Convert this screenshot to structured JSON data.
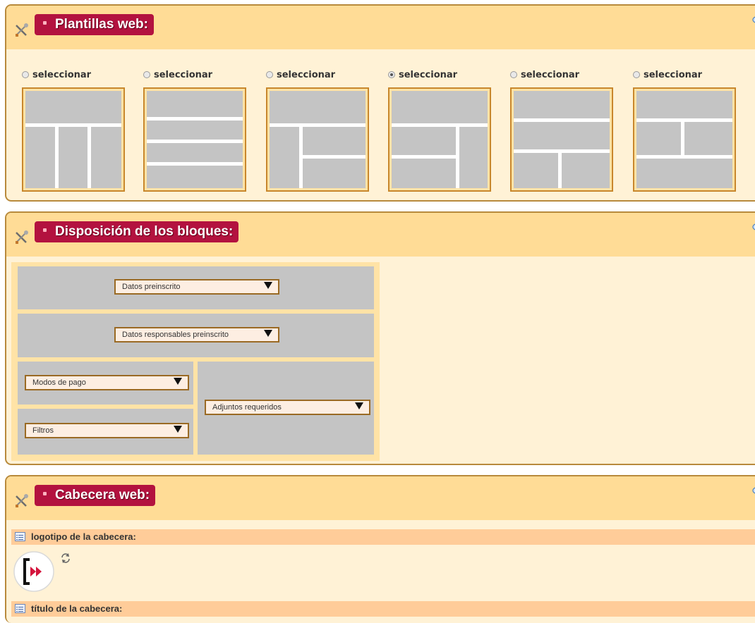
{
  "panels": {
    "templates": {
      "title": "Plantillas web:",
      "options": [
        {
          "label": "seleccionar",
          "selected": false
        },
        {
          "label": "seleccionar",
          "selected": false
        },
        {
          "label": "seleccionar",
          "selected": false
        },
        {
          "label": "seleccionar",
          "selected": true
        },
        {
          "label": "seleccionar",
          "selected": false
        },
        {
          "label": "seleccionar",
          "selected": false
        }
      ]
    },
    "layout": {
      "title": "Disposición de los bloques:",
      "selects": {
        "top": "Datos preinscrito",
        "second": "Datos responsables preinscrito",
        "left_top": "Modos de pago",
        "left_bottom": "Filtros",
        "right": "Adjuntos requeridos"
      }
    },
    "header": {
      "title": "Cabecera web:",
      "logo_field_label": "logotipo de la cabecera:",
      "title_field_label": "título de la cabecera:"
    }
  },
  "icons": {
    "tools": "tools-icon",
    "visibility": "eye-icon",
    "field": "list-icon",
    "refresh": "refresh-icon",
    "logo": "logo-icon"
  },
  "colors": {
    "panel_bg": "#fff2d6",
    "panel_header": "#ffdc96",
    "title_badge": "#b3123f",
    "field_header": "#ffcc99",
    "thumb_border": "#c8872c",
    "block_gray": "#c4c4c4"
  }
}
